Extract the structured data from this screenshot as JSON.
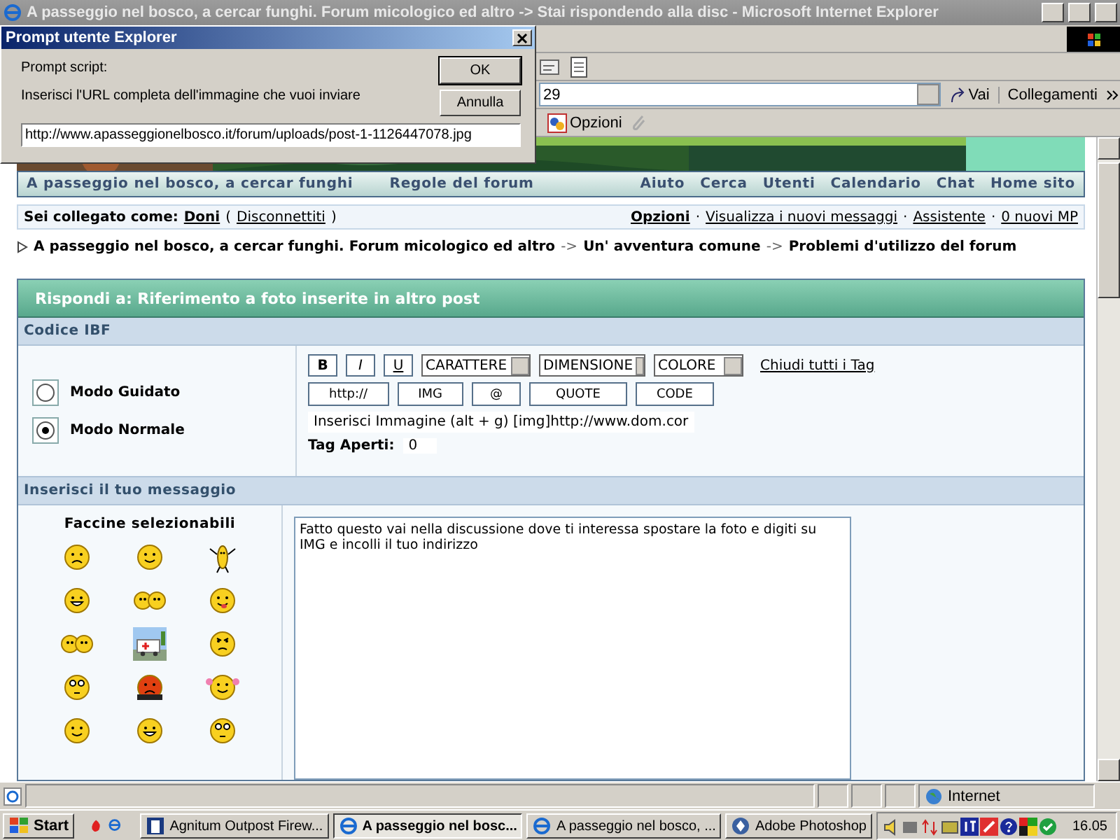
{
  "window": {
    "title": "A passeggio nel bosco, a cercar funghi. Forum micologico ed altro -> Stai rispondendo alla disc - Microsoft Internet Explorer"
  },
  "dialog": {
    "title": "Prompt utente Explorer",
    "label": "Prompt script:",
    "message": "Inserisci l'URL completa dell'immagine che vuoi inviare",
    "value": "http://www.apasseggionelbosco.it/forum/uploads/post-1-1126447078.jpg",
    "buttons": [
      "OK",
      "Annulla"
    ]
  },
  "address": {
    "value": "29",
    "go": "Vai",
    "links": "Collegamenti"
  },
  "links_bar": {
    "items": [
      "Opzioni"
    ]
  },
  "nav": {
    "left": [
      "A passeggio nel bosco, a cercar funghi",
      "Regole del forum"
    ],
    "right": [
      "Aiuto",
      "Cerca",
      "Utenti",
      "Calendario",
      "Chat",
      "Home sito"
    ]
  },
  "user_bar": {
    "label": "Sei collegato come:",
    "user": "Doni",
    "paren_open": "(",
    "logout": "Disconnettiti",
    "paren_close": ")",
    "links": [
      {
        "label": "Opzioni",
        "bold": true
      },
      {
        "label": "Visualizza i nuovi messaggi",
        "bold": false
      },
      {
        "label": "Assistente",
        "bold": false
      },
      {
        "label": "0 nuovi MP",
        "bold": false
      }
    ],
    "separators": [
      "·",
      "·",
      "·"
    ]
  },
  "breadcrumb": {
    "items": [
      "A passeggio nel bosco, a cercar funghi. Forum micologico ed altro",
      "Un' avventura comune",
      "Problemi d'utilizzo del forum"
    ],
    "separators": [
      "->",
      "->"
    ]
  },
  "panel": {
    "title": "Rispondi a: Riferimento a foto inserite in altro post",
    "code_section": "Codice IBF",
    "modes": [
      {
        "label": "Modo Guidato",
        "selected": false
      },
      {
        "label": "Modo Normale",
        "selected": true
      }
    ],
    "format_buttons": [
      {
        "label": "B",
        "kind": "bold"
      },
      {
        "label": "I",
        "kind": "italic"
      },
      {
        "label": "U",
        "kind": "underline"
      }
    ],
    "selects": [
      "CARATTERE",
      "DIMENSIONE",
      "COLORE"
    ],
    "close_tags": "Chiudi tutti i Tag",
    "tag_buttons": [
      "http://",
      "IMG",
      "@",
      "QUOTE",
      "CODE"
    ],
    "hint": "Inserisci Immagine (alt + g) [img]http://www.dom.cor",
    "tags_open": {
      "label": "Tag Aperti:",
      "value": "0"
    },
    "message_section": "Inserisci il tuo messaggio",
    "smileys_title": "Faccine selezionabili",
    "smileys": [
      {
        "kind": "sad"
      },
      {
        "kind": "smile"
      },
      {
        "kind": "dancer"
      },
      {
        "kind": "grin"
      },
      {
        "kind": "pair"
      },
      {
        "kind": "tongue"
      },
      {
        "kind": "pair"
      },
      {
        "kind": "ambulance"
      },
      {
        "kind": "angry"
      },
      {
        "kind": "roll"
      },
      {
        "kind": "red"
      },
      {
        "kind": "cheer"
      },
      {
        "kind": "smile"
      },
      {
        "kind": "grin"
      },
      {
        "kind": "roll"
      }
    ],
    "message": "Fatto questo vai nella discussione dove ti interessa spostare la foto e digiti su IMG e incolli il tuo indirizzo"
  },
  "status_bar": {
    "zone": "Internet"
  },
  "taskbar": {
    "start": "Start",
    "tasks": [
      {
        "label": "Agnitum Outpost Firew...",
        "selected": false
      },
      {
        "label": "A passeggio nel bosc...",
        "selected": true
      },
      {
        "label": "A passeggio nel bosco, ...",
        "selected": false
      },
      {
        "label": "Adobe Photoshop",
        "selected": false
      }
    ],
    "clock": "16.05"
  }
}
